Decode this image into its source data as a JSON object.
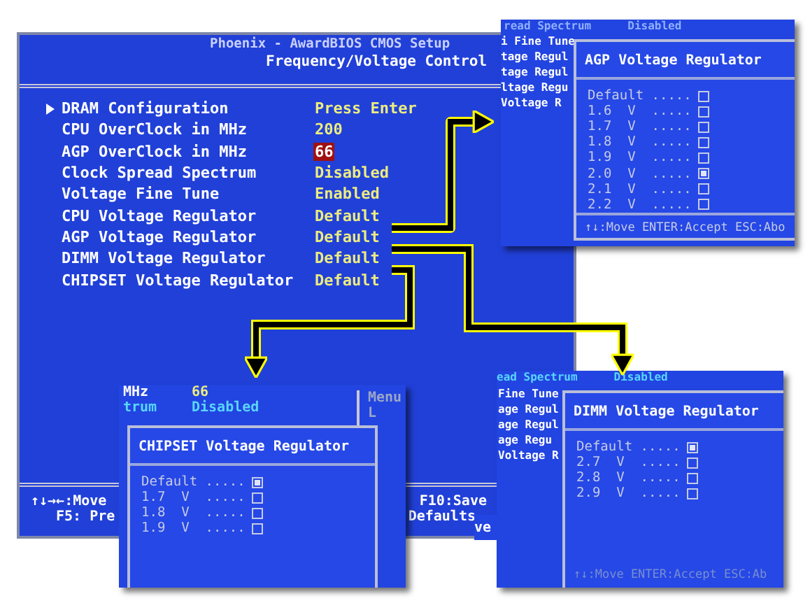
{
  "main_screen": {
    "title": "Phoenix - AwardBIOS CMOS Setup",
    "subtitle": "Frequency/Voltage Control",
    "rows": [
      {
        "kind": "submenu",
        "label": "DRAM Configuration",
        "value": "Press Enter",
        "selected": false
      },
      {
        "kind": "setting",
        "label": "CPU OverClock in MHz",
        "value": "200",
        "selected": false
      },
      {
        "kind": "setting",
        "label": "AGP OverClock in MHz",
        "value": "66",
        "selected": true
      },
      {
        "kind": "setting",
        "label": "Clock Spread Spectrum",
        "value": "Disabled",
        "selected": false
      },
      {
        "kind": "setting",
        "label": "Voltage Fine Tune",
        "value": "Enabled",
        "selected": false
      },
      {
        "kind": "setting",
        "label": "CPU Voltage Regulator",
        "value": "Default",
        "selected": false
      },
      {
        "kind": "setting",
        "label": "AGP Voltage Regulator",
        "value": "Default",
        "selected": false
      },
      {
        "kind": "setting",
        "label": "DIMM Voltage Regulator",
        "value": "Default",
        "selected": false
      },
      {
        "kind": "setting",
        "label": "CHIPSET Voltage Regulator",
        "value": "Default",
        "selected": false
      }
    ],
    "footer_left": [
      "↑↓→←:Move",
      "F5: Pre"
    ],
    "footer_right": [
      "F10:Save",
      "Defaults"
    ]
  },
  "agp_popup": {
    "backdrop_top": [
      "read Spectrum",
      "Disabled"
    ],
    "backdrop_lines": [
      "i Fine Tune",
      "tage Regul",
      "tage Regul",
      "ltage Regu",
      "Voltage R"
    ],
    "title": "AGP Voltage Regulator",
    "options": [
      {
        "label": "Default .....",
        "checked": false
      },
      {
        "label": "1.6  V  .....",
        "checked": false
      },
      {
        "label": "1.7  V  .....",
        "checked": false
      },
      {
        "label": "1.8  V  .....",
        "checked": false
      },
      {
        "label": "1.9  V  .....",
        "checked": false
      },
      {
        "label": "2.0  V  .....",
        "checked": true
      },
      {
        "label": "2.1  V  .....",
        "checked": false
      },
      {
        "label": "2.2  V  .....",
        "checked": false
      }
    ],
    "footer": "↑↓:Move ENTER:Accept ESC:Abo"
  },
  "chipset_popup": {
    "backdrop_rows": [
      {
        "label": "MHz",
        "value": "66"
      },
      {
        "label": "trum",
        "value": "Disabled"
      }
    ],
    "backdrop_side": "Menu L",
    "title": "CHIPSET Voltage Regulator",
    "options": [
      {
        "label": "Default .....",
        "checked": true
      },
      {
        "label": "1.7  V  .....",
        "checked": false
      },
      {
        "label": "1.8  V  .....",
        "checked": false
      },
      {
        "label": "1.9  V  .....",
        "checked": false
      }
    ]
  },
  "dimm_popup": {
    "backdrop_top": [
      "ead Spectrum",
      "Disabled"
    ],
    "backdrop_lines": [
      "Fine Tune",
      "age Regul",
      "age Regul",
      "age Regu",
      "Voltage R"
    ],
    "backdrop_footer": "ve",
    "title": "DIMM Voltage Regulator",
    "options": [
      {
        "label": "Default .....",
        "checked": true
      },
      {
        "label": "2.7  V  .....",
        "checked": false
      },
      {
        "label": "2.8  V  .....",
        "checked": false
      },
      {
        "label": "2.9  V  .....",
        "checked": false
      }
    ],
    "footer": "↑↓:Move ENTER:Accept ESC:Ab"
  }
}
